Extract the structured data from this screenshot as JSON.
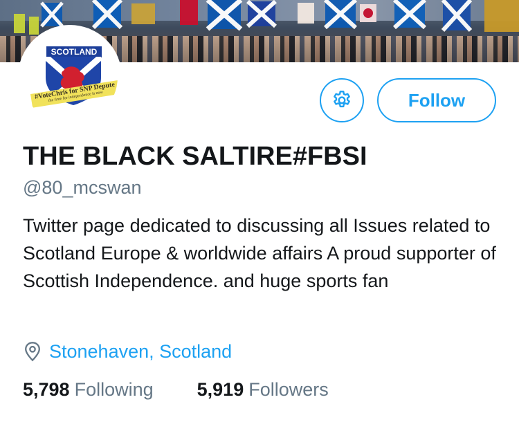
{
  "profile": {
    "avatar_badge_text": "SCOTLAND",
    "avatar_banner_line1": "#VoteChris for SNP Depute",
    "avatar_banner_line2": "the time for independence is now",
    "display_name": "THE BLACK SALTIRE#FBSI",
    "handle": "@80_mcswan",
    "bio": "Twitter page dedicated to discussing all Issues related to Scotland Europe & worldwide affairs A proud supporter of Scottish Independence. and huge sports fan",
    "location": "Stonehaven, Scotland"
  },
  "actions": {
    "follow_label": "Follow",
    "settings_icon": "gear-icon"
  },
  "stats": {
    "following_count": "5,798",
    "following_label": "Following",
    "followers_count": "5,919",
    "followers_label": "Followers"
  },
  "colors": {
    "accent": "#1da1f2",
    "text_primary": "#14171a",
    "text_secondary": "#657786"
  }
}
